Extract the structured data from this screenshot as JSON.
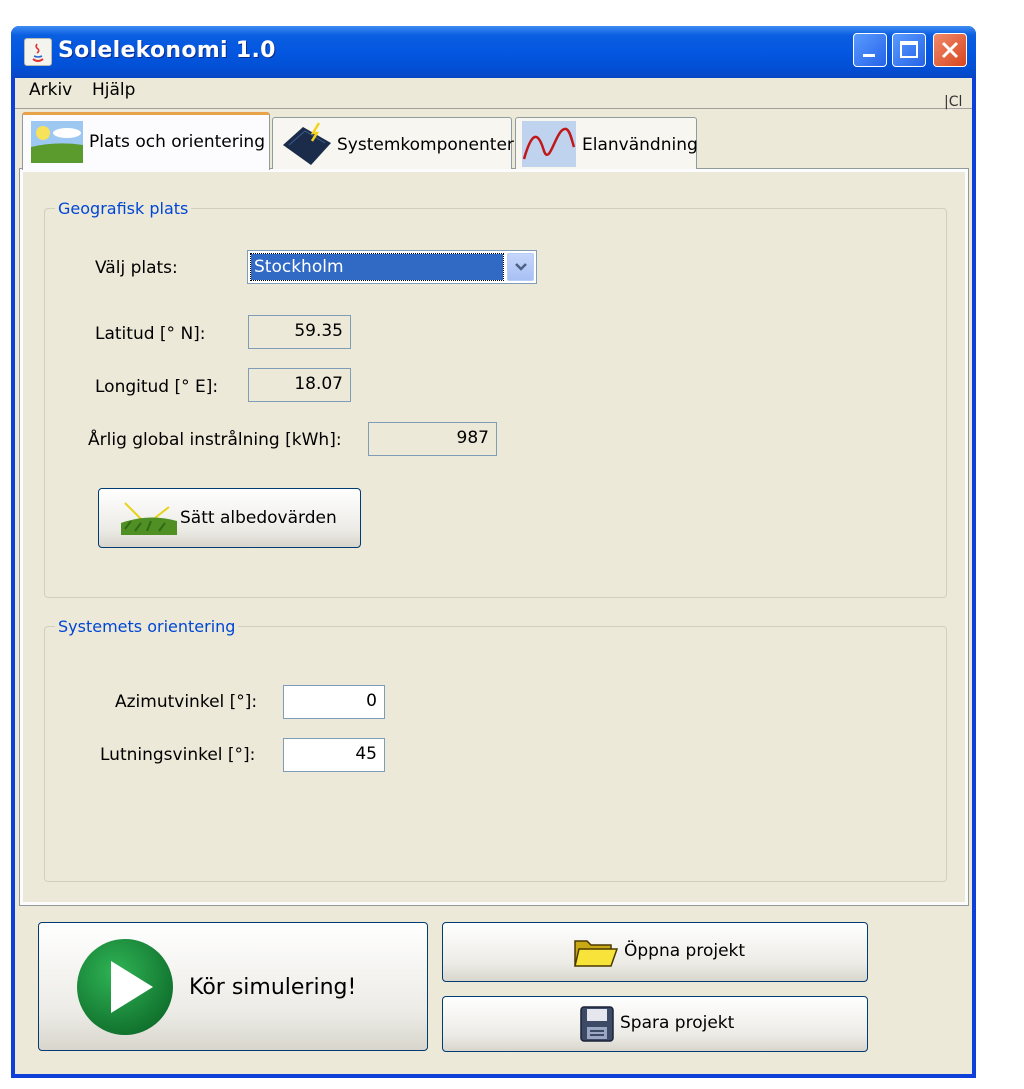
{
  "window": {
    "title": "Solelekonomi 1.0",
    "titlebar_color": "#0457e0"
  },
  "menu": {
    "items": [
      "Arkiv",
      "Hjälp"
    ],
    "clipped_text": "|Cl"
  },
  "tabs": [
    {
      "label": "Plats och orientering",
      "selected": true,
      "icon": "landscape-icon"
    },
    {
      "label": "Systemkomponenter",
      "selected": false,
      "icon": "solar-panel-icon"
    },
    {
      "label": "Elanvändning",
      "selected": false,
      "icon": "wave-chart-icon"
    }
  ],
  "geo": {
    "title": "Geografisk plats",
    "place_label": "Välj plats:",
    "place_value": "Stockholm",
    "lat_label": "Latitud [° N]:",
    "lat_value": "59.35",
    "lon_label": "Longitud [° E]:",
    "lon_value": "18.07",
    "irr_label": "Årlig global instrålning [kWh]:",
    "irr_value": "987",
    "albedo_button": "Sätt albedovärden"
  },
  "orient": {
    "title": "Systemets orientering",
    "azimuth_label": "Azimutvinkel [°]:",
    "azimuth_value": "0",
    "tilt_label": "Lutningsvinkel [°]:",
    "tilt_value": "45"
  },
  "actions": {
    "run_label": "Kör simulering!",
    "open_label": "Öppna projekt",
    "save_label": "Spara projekt"
  },
  "colors": {
    "accent": "#316ac5",
    "group_title": "#0046d5",
    "run_green": "#1a8f3c",
    "selected_tab_marker": "#e8a24a"
  }
}
